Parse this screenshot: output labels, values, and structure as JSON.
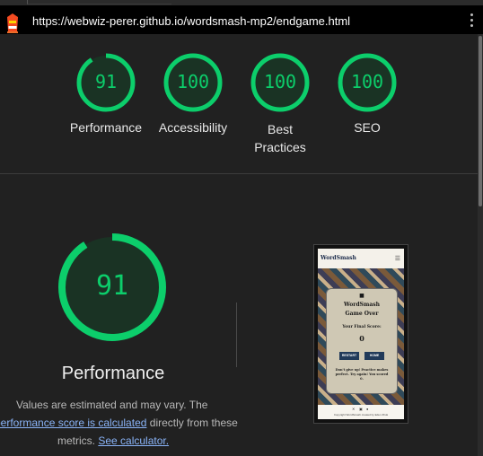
{
  "browser": {
    "url": "https://webwiz-perer.github.io/wordsmash-mp2/endgame.html"
  },
  "summary": [
    {
      "score": "91",
      "label": "Performance",
      "value": 0.91
    },
    {
      "score": "100",
      "label": "Accessibility",
      "value": 1.0
    },
    {
      "score": "100",
      "label": "Best Practices",
      "value": 1.0
    },
    {
      "score": "100",
      "label": "SEO",
      "value": 1.0
    }
  ],
  "performance": {
    "score": "91",
    "value": 0.91,
    "title": "Performance",
    "note_prefix": "Values are estimated and may vary. The",
    "note_link1": "performance score is calculated",
    "note_mid": "directly from these",
    "note_end": "metrics.",
    "note_link2": "See calculator."
  },
  "screenshot": {
    "brand": "WordSmash",
    "card_title1": "WordSmash",
    "card_title2": "Game Over",
    "score_label": "Your Final Score:",
    "score_value": "0",
    "btn_restart": "RESTART",
    "btn_home": "HOME",
    "message": "Don't give up! Practice makes perfect. Try again! You scored 0.",
    "footer": "Copyright WordSmash created by Eden Zhuk"
  },
  "colors": {
    "pass": "#0cce6b",
    "pass_bg": "#1a3324",
    "background": "#212121",
    "link": "#8ab4f8"
  },
  "icons": [
    "lighthouse-icon",
    "kebab-menu-icon",
    "hamburger-icon",
    "x-social-icon",
    "instagram-icon",
    "github-icon"
  ]
}
